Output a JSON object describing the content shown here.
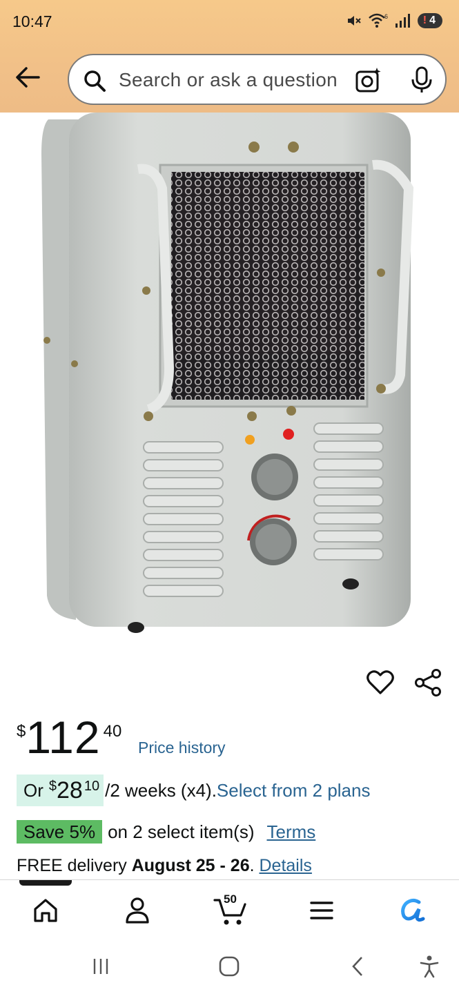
{
  "status_bar": {
    "time": "10:47",
    "wifi_badge": "6",
    "battery_level": "4"
  },
  "search": {
    "placeholder": "Search or ask a question"
  },
  "icons": {
    "back": "back-arrow-icon",
    "search": "search-icon",
    "camera": "camera-lens-icon",
    "mic": "microphone-icon",
    "wishlist": "heart-icon",
    "share": "share-icon"
  },
  "price": {
    "symbol": "$",
    "whole": "112",
    "fraction": "40",
    "history_link": "Price history"
  },
  "installment": {
    "prefix": "Or",
    "symbol": "$",
    "whole": "28",
    "fraction": "10",
    "term": "/2 weeks (x4).",
    "link": "Select from 2 plans"
  },
  "savings": {
    "badge": "Save 5%",
    "text": "on 2 select item(s)",
    "link": "Terms"
  },
  "delivery": {
    "prefix": "FREE delivery",
    "dates": "August 25 - 26",
    "period": ".",
    "link": "Details"
  },
  "bottom_nav": {
    "items": [
      "home",
      "account",
      "cart",
      "menu",
      "rufus"
    ],
    "cart_count": "50",
    "active": "home"
  },
  "colors": {
    "header_bg": "#f3c487",
    "link": "#2a6491",
    "save_badge": "#5dbb63",
    "installment_highlight": "#d7f3e9",
    "rufus_accent": "#1a8cd8"
  }
}
